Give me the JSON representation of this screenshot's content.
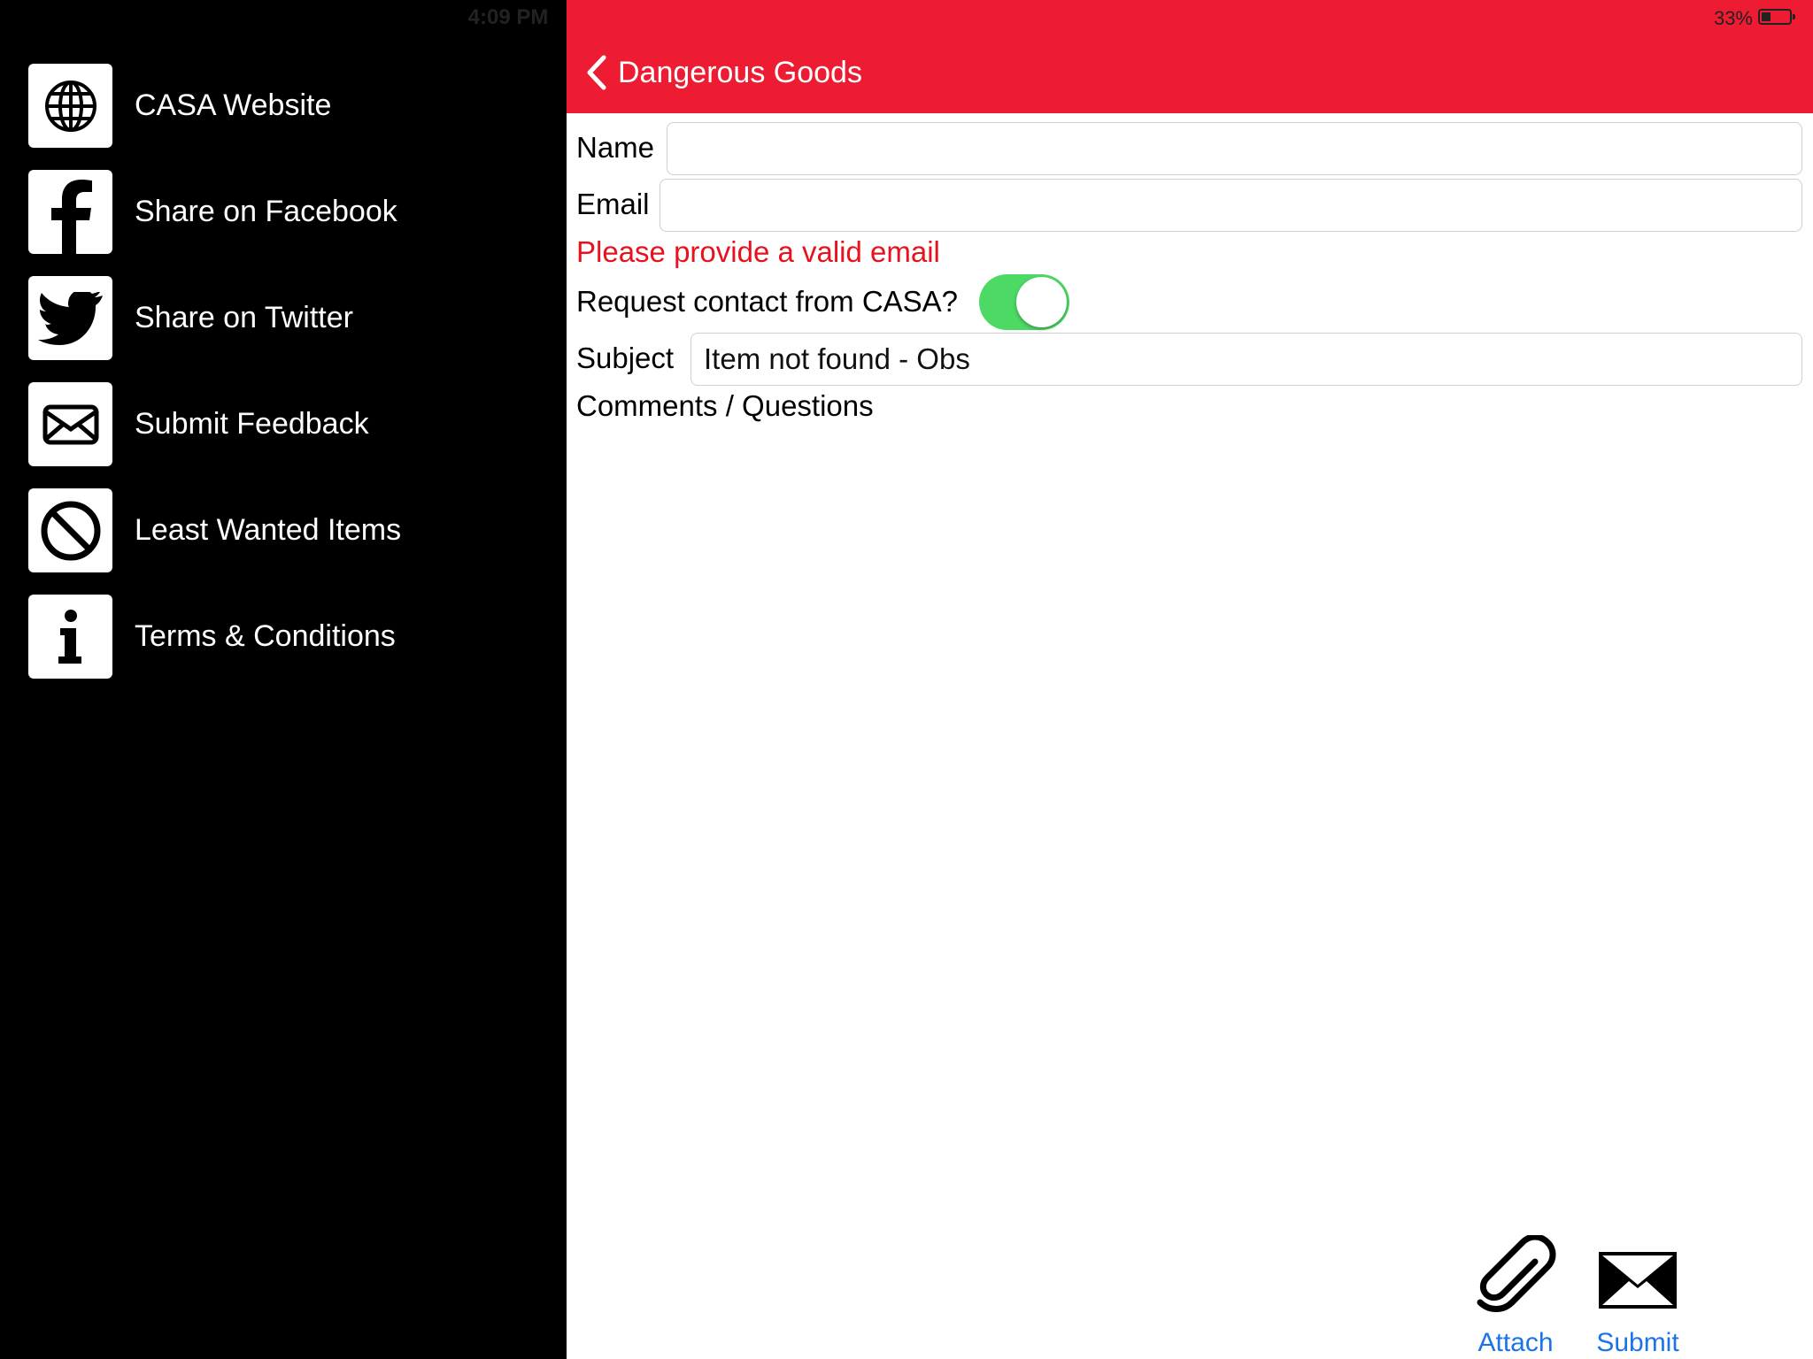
{
  "status": {
    "time": "4:09 PM",
    "battery_text": "33%",
    "battery_level": 0.33
  },
  "sidebar": {
    "items": [
      {
        "label": "CASA Website",
        "icon": "globe-icon"
      },
      {
        "label": "Share on Facebook",
        "icon": "facebook-icon"
      },
      {
        "label": "Share on Twitter",
        "icon": "twitter-icon"
      },
      {
        "label": "Submit Feedback",
        "icon": "envelope-icon"
      },
      {
        "label": "Least Wanted Items",
        "icon": "prohibited-icon"
      },
      {
        "label": "Terms & Conditions",
        "icon": "info-icon"
      }
    ]
  },
  "nav": {
    "back_title": "Dangerous Goods",
    "bar_color": "#ee1c32"
  },
  "form": {
    "name_label": "Name",
    "name_value": "",
    "email_label": "Email",
    "email_value": "",
    "email_error": "Please provide a valid email",
    "contact_label": "Request contact from CASA?",
    "contact_on": true,
    "subject_label": "Subject",
    "subject_value": "Item not found - Obs",
    "comments_label": "Comments / Questions",
    "comments_value": ""
  },
  "actions": {
    "attach_label": "Attach",
    "submit_label": "Submit"
  }
}
